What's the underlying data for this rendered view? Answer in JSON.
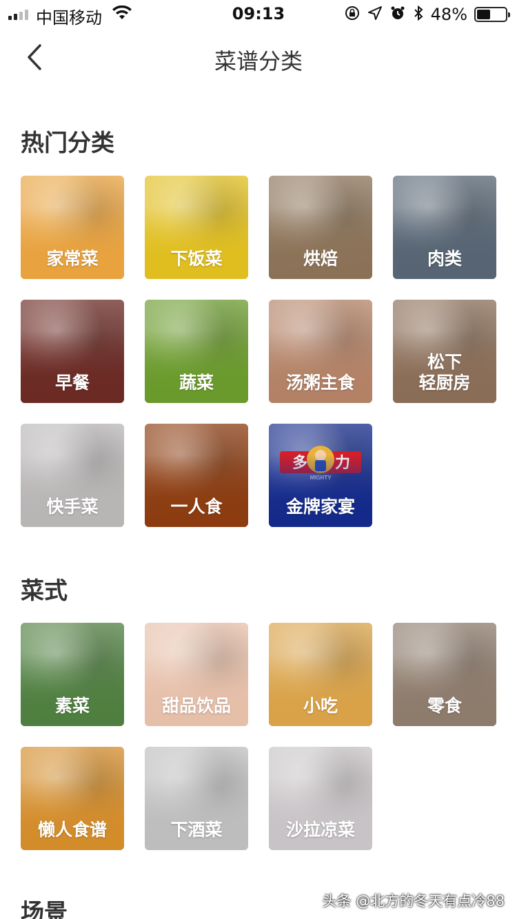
{
  "status_bar": {
    "carrier": "中国移动",
    "time": "09:13",
    "battery": "48%",
    "battery_level": 0.48
  },
  "nav": {
    "title": "菜谱分类",
    "back_icon": "chevron-left-icon"
  },
  "sections": [
    {
      "title": "热门分类",
      "items": [
        {
          "label": "家常菜",
          "color": "#e8a23e"
        },
        {
          "label": "下饭菜",
          "color": "#e0be1f"
        },
        {
          "label": "烘焙",
          "color": "#8b7257"
        },
        {
          "label": "肉类",
          "color": "#566473"
        },
        {
          "label": "早餐",
          "color": "#6b2a24"
        },
        {
          "label": "蔬菜",
          "color": "#6a9a2c"
        },
        {
          "label": "汤粥主食",
          "color": "#b38266"
        },
        {
          "label": "松下\n轻厨房",
          "color": "#8a6d57"
        },
        {
          "label": "快手菜",
          "color": "#b8b5b5"
        },
        {
          "label": "一人食",
          "color": "#8c3c10"
        },
        {
          "label": "金牌家宴",
          "color": "#142a8a",
          "logo": {
            "left": "多",
            "right": "力",
            "sub": "MIGHTY"
          }
        }
      ]
    },
    {
      "title": "菜式",
      "items": [
        {
          "label": "素菜",
          "color": "#4f7f40"
        },
        {
          "label": "甜品饮品",
          "color": "#e6bfa9"
        },
        {
          "label": "小吃",
          "color": "#d9a248"
        },
        {
          "label": "零食",
          "color": "#8d7b6c"
        },
        {
          "label": "懒人食谱",
          "color": "#d38c2a"
        },
        {
          "label": "下酒菜",
          "color": "#bdbdbd"
        },
        {
          "label": "沙拉凉菜",
          "color": "#c8c3c6"
        }
      ]
    },
    {
      "title": "场景",
      "items": []
    }
  ],
  "watermark": "头条 @北方的冬天有点冷88"
}
